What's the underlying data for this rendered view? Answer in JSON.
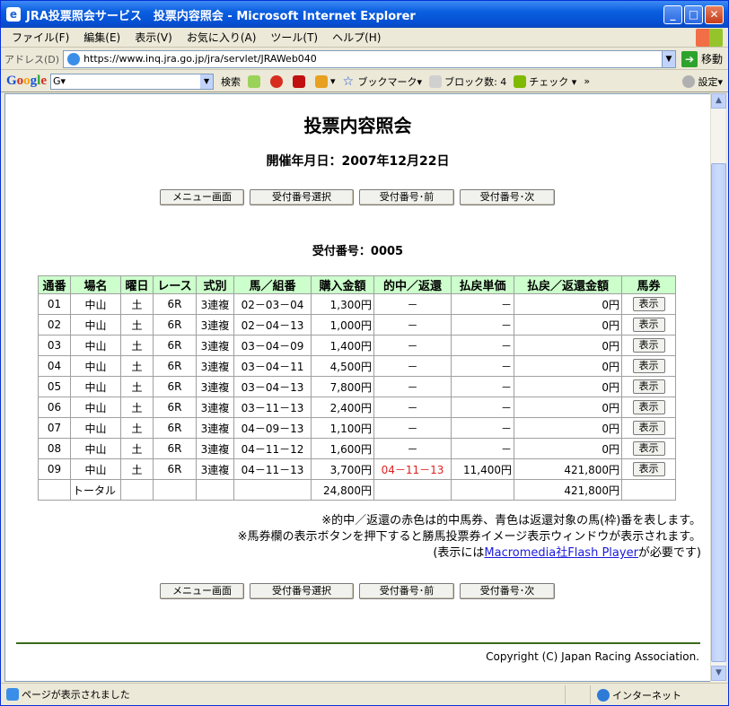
{
  "window": {
    "title": "JRA投票照会サービス　投票内容照会 - Microsoft Internet Explorer",
    "min": "_",
    "max": "□",
    "close": "✕"
  },
  "menu": [
    "ファイル(F)",
    "編集(E)",
    "表示(V)",
    "お気に入り(A)",
    "ツール(T)",
    "ヘルプ(H)"
  ],
  "address": {
    "label": "アドレス(D)",
    "url": "https://www.inq.jra.go.jp/jra/servlet/JRAWeb040",
    "go": "移動"
  },
  "google": {
    "logo": [
      "G",
      "o",
      "o",
      "g",
      "l",
      "e"
    ],
    "search_prefix": "G▾",
    "search_label": "検索",
    "bookmark": "ブックマーク▾",
    "block": "ブロック数: 4",
    "check": "チェック ▾",
    "more": "»",
    "settings": "設定▾"
  },
  "page": {
    "title": "投票内容照会",
    "date": "開催年月日：2007年12月22日",
    "buttons": [
      "メニュー画面",
      "受付番号選択",
      "受付番号･前",
      "受付番号･次"
    ],
    "receipt": "受付番号：0005"
  },
  "table": {
    "headers": [
      "通番",
      "場名",
      "曜日",
      "レース",
      "式別",
      "馬／組番",
      "購入金額",
      "的中／返還",
      "払戻単価",
      "払戻／返還金額",
      "馬券"
    ],
    "rows": [
      {
        "no": "01",
        "place": "中山",
        "day": "土",
        "race": "6R",
        "type": "3連複",
        "combo": "02－03－04",
        "amount": "1,300円",
        "hit": "－",
        "unit": "－",
        "payout": "0円",
        "btn": "表示"
      },
      {
        "no": "02",
        "place": "中山",
        "day": "土",
        "race": "6R",
        "type": "3連複",
        "combo": "02－04－13",
        "amount": "1,000円",
        "hit": "－",
        "unit": "－",
        "payout": "0円",
        "btn": "表示"
      },
      {
        "no": "03",
        "place": "中山",
        "day": "土",
        "race": "6R",
        "type": "3連複",
        "combo": "03－04－09",
        "amount": "1,400円",
        "hit": "－",
        "unit": "－",
        "payout": "0円",
        "btn": "表示"
      },
      {
        "no": "04",
        "place": "中山",
        "day": "土",
        "race": "6R",
        "type": "3連複",
        "combo": "03－04－11",
        "amount": "4,500円",
        "hit": "－",
        "unit": "－",
        "payout": "0円",
        "btn": "表示"
      },
      {
        "no": "05",
        "place": "中山",
        "day": "土",
        "race": "6R",
        "type": "3連複",
        "combo": "03－04－13",
        "amount": "7,800円",
        "hit": "－",
        "unit": "－",
        "payout": "0円",
        "btn": "表示"
      },
      {
        "no": "06",
        "place": "中山",
        "day": "土",
        "race": "6R",
        "type": "3連複",
        "combo": "03－11－13",
        "amount": "2,400円",
        "hit": "－",
        "unit": "－",
        "payout": "0円",
        "btn": "表示"
      },
      {
        "no": "07",
        "place": "中山",
        "day": "土",
        "race": "6R",
        "type": "3連複",
        "combo": "04－09－13",
        "amount": "1,100円",
        "hit": "－",
        "unit": "－",
        "payout": "0円",
        "btn": "表示"
      },
      {
        "no": "08",
        "place": "中山",
        "day": "土",
        "race": "6R",
        "type": "3連複",
        "combo": "04－11－12",
        "amount": "1,600円",
        "hit": "－",
        "unit": "－",
        "payout": "0円",
        "btn": "表示"
      },
      {
        "no": "09",
        "place": "中山",
        "day": "土",
        "race": "6R",
        "type": "3連複",
        "combo": "04－11－13",
        "amount": "3,700円",
        "hit": "04－11－13",
        "unit": "11,400円",
        "payout": "421,800円",
        "btn": "表示"
      }
    ],
    "total": {
      "label": "トータル",
      "amount": "24,800円",
      "payout": "421,800円"
    }
  },
  "notes": {
    "line1": "※的中／返還の赤色は的中馬券、青色は返還対象の馬(枠)番を表します。",
    "line2": "※馬券欄の表示ボタンを押下すると勝馬投票券イメージ表示ウィンドウが表示されます。",
    "line3_pre": "(表示には",
    "line3_link": "Macromedia社Flash Player",
    "line3_post": "が必要です)"
  },
  "copyright": "Copyright (C) Japan Racing Association.",
  "status": {
    "text": "ページが表示されました",
    "zone": "インターネット"
  },
  "colors": {
    "header_bg": "#ccffcc",
    "hit_red": "#e02020",
    "rule": "#3a6b1a"
  }
}
